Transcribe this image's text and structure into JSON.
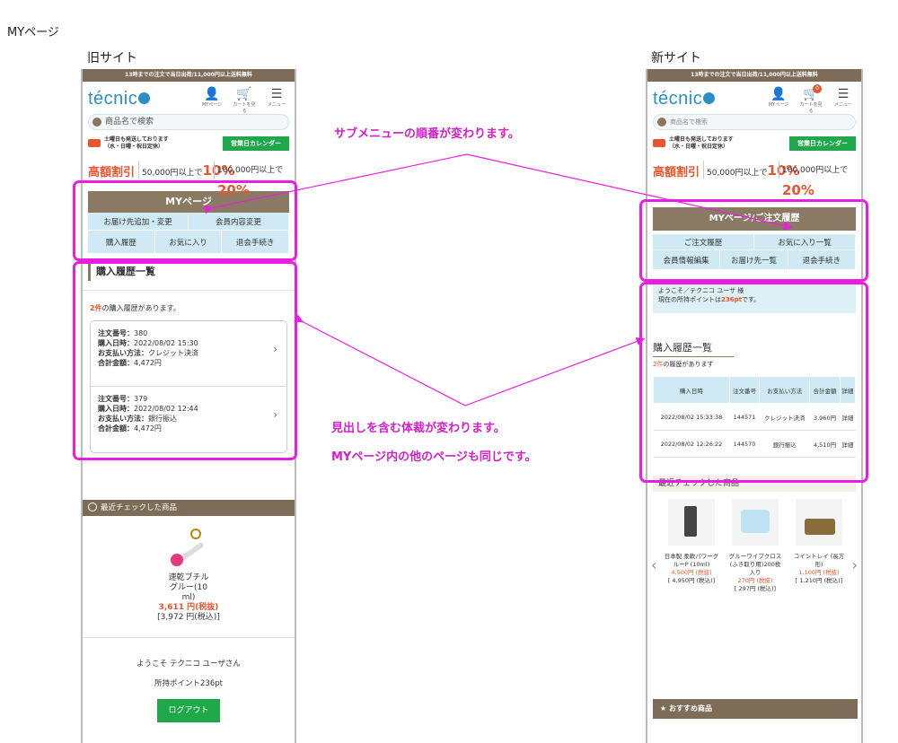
{
  "page_title": "MYページ",
  "old_label": "旧サイト",
  "new_label": "新サイト",
  "common": {
    "topbar": "13時までの注文で当日出荷/11,000円以上送料無料",
    "logo": "técnic",
    "search_placeholder": "商品名で検索",
    "notice_line1": "土曜日も発送しております",
    "notice_line2": "（水・日曜・祝日定休）",
    "calendar_btn": "営業日カレンダー",
    "promo_big": "高額割引",
    "promo1_amount": "50,000円以上で",
    "promo1_pct": "10%",
    "promo2_amount": "100,000円以上で",
    "promo2_pct": "20%",
    "icon_mypage": "MYページ",
    "icon_cart": "カートを見る",
    "icon_menu": "メニュー",
    "cart_count": "0"
  },
  "old": {
    "section_head": "MYページ",
    "tabs_row1": [
      "お届け先追加・変更",
      "会員内容変更"
    ],
    "tabs_row2": [
      "購入履歴",
      "お気に入り",
      "退会手続き"
    ],
    "page_heading": "購入履歴一覧",
    "count_num": "2件",
    "count_text": "の購入履歴があります。",
    "orders": [
      {
        "no_label": "注文番号：",
        "no": "380",
        "date_label": "購入日時：",
        "date": "2022/08/02 15:30",
        "pay_label": "お支払い方法：",
        "pay": "クレジット決済",
        "total_label": "合計金額：",
        "total": "4,472円"
      },
      {
        "no_label": "注文番号：",
        "no": "379",
        "date_label": "購入日時：",
        "date": "2022/08/02 12:44",
        "pay_label": "お支払い方法：",
        "pay": "銀行振込",
        "total_label": "合計金額：",
        "total": "4,472円"
      }
    ],
    "recent_head": "最近チェックした商品",
    "recent_product": {
      "name1": "速乾ブチル",
      "name2": "グルー(10",
      "name3": "ml)",
      "price": "3,611 円(税抜)",
      "price_tax": "[3,972 円(税込)]"
    },
    "welcome": "ようこそ テクニコ ユーザさん",
    "points": "所持ポイント236pt",
    "logout": "ログアウト"
  },
  "new": {
    "section_head": "MYページ/ご注文履歴",
    "tabs_row1": [
      "ご注文履歴",
      "お気に入り一覧"
    ],
    "tabs_row2": [
      "会員情報編集",
      "お届け先一覧",
      "退会手続き"
    ],
    "welcome_line1": "ようこそ／テクニコ ユーザ 様",
    "welcome_line2_pre": "現在の所持ポイントは",
    "welcome_points": "236pt",
    "welcome_line2_post": "です。",
    "page_heading": "購入履歴一覧",
    "count_num": "2件",
    "count_text": "の履歴があります",
    "table_headers": [
      "購入日時",
      "注文番号",
      "お支払い方法",
      "合計金額",
      "詳細"
    ],
    "rows": [
      [
        "2022/08/02 15:33:38",
        "144571",
        "クレジット決済",
        "3,960円",
        "詳細"
      ],
      [
        "2022/08/02 12:26:22",
        "144570",
        "銀行振込",
        "4,510円",
        "詳細"
      ]
    ],
    "recent_head": "最近チェックした商品",
    "products": [
      {
        "name": "日本製 柔軟パワーグルーP (10ml)",
        "price": "4,500円 (税抜)",
        "price_tax": "[ 4,950円 (税込)]"
      },
      {
        "name": "グルーワイプクロス(ふき取り用)200枚入り",
        "price": "270円 (税抜)",
        "price_tax": "[ 297円 (税込)]"
      },
      {
        "name": "コイントレイ (長方形)",
        "price": "1,100円 (税抜)",
        "price_tax": "[ 1,210円 (税込)]"
      }
    ],
    "reco_head": "おすすめ商品"
  },
  "annotations": {
    "submenu": "サブメニューの順番が変わります。",
    "layout1": "見出しを含む体裁が変わります。",
    "layout2": "MYページ内の他のページも同じです。"
  },
  "colors": {
    "annotation": "#e91ee0",
    "brown": "#8a7a64",
    "tab_bg": "#cfeaf4",
    "accent": "#e8562f",
    "green": "#1fa84a",
    "logo_blue": "#2a8fc4"
  }
}
